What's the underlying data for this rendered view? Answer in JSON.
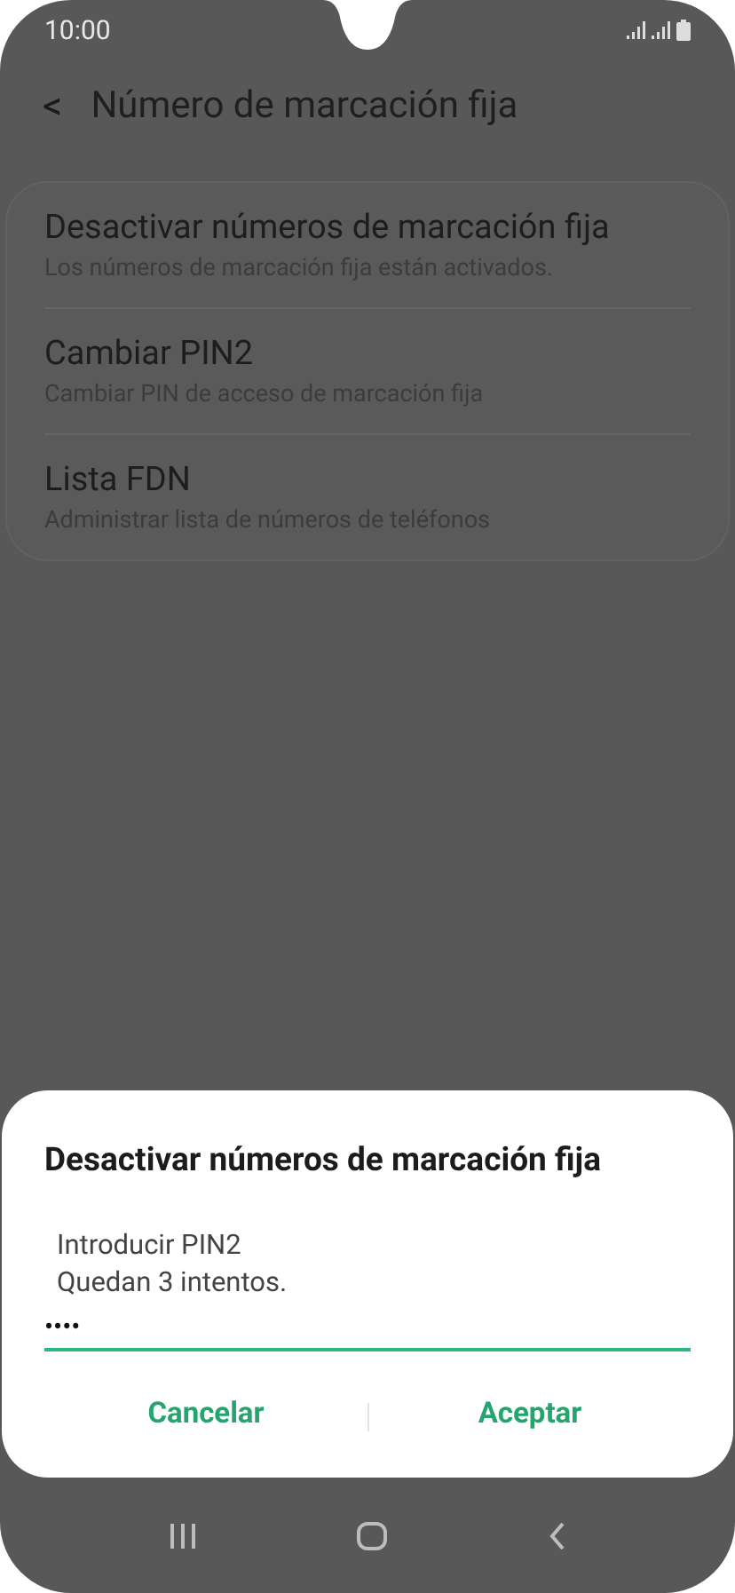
{
  "status_bar": {
    "time": "10:00"
  },
  "header": {
    "back": "<",
    "title": "Número de marcación fija"
  },
  "settings": [
    {
      "title": "Desactivar números de marcación fija",
      "subtitle": "Los números de marcación fija están activados."
    },
    {
      "title": "Cambiar PIN2",
      "subtitle": "Cambiar PIN de acceso de marcación fija"
    },
    {
      "title": "Lista FDN",
      "subtitle": "Administrar lista de números de teléfonos"
    }
  ],
  "dialog": {
    "title": "Desactivar números de marcación fija",
    "message": [
      "Introducir PIN2",
      "Quedan 3 intentos."
    ],
    "pin_value": "••••",
    "buttons": [
      "Cancelar",
      "Aceptar"
    ]
  }
}
